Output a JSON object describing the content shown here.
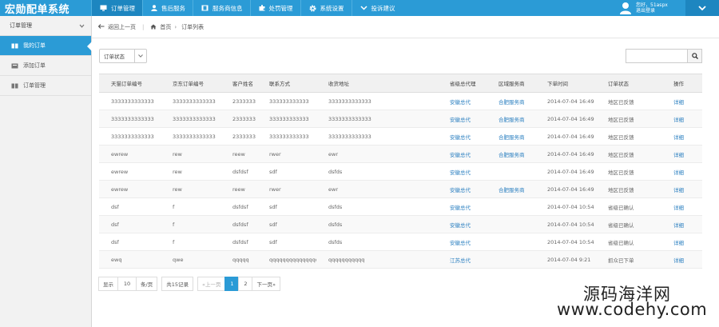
{
  "app": {
    "brand": "宏勋配单系统"
  },
  "nav": [
    {
      "label": "订单管理",
      "icon": "monitor-icon"
    },
    {
      "label": "售后服务",
      "icon": "user-icon"
    },
    {
      "label": "服务商信息",
      "icon": "film-icon"
    },
    {
      "label": "处罚管理",
      "icon": "puzzle-icon"
    },
    {
      "label": "系统设置",
      "icon": "gear-icon"
    },
    {
      "label": "投诉建议",
      "icon": "chevron-down-icon"
    }
  ],
  "user": {
    "welcome": "您好，51aspx",
    "logout": "退出登录"
  },
  "sidebar": {
    "header": "订单管理",
    "items": [
      {
        "label": "我的订单",
        "active": true
      },
      {
        "label": "添加订单",
        "active": false
      },
      {
        "label": "订单管理",
        "active": false
      }
    ]
  },
  "breadcrumb": {
    "back": "返回上一页",
    "home": "首页",
    "current": "订单列表"
  },
  "filter": {
    "status_label": "订单状态",
    "search_placeholder": ""
  },
  "table": {
    "columns": [
      "天猫订单编号",
      "京东订单编号",
      "客户姓名",
      "联系方式",
      "收货地址",
      "省级总代理",
      "区域服务商",
      "下单时间",
      "订单状态",
      "操作"
    ],
    "rows": [
      {
        "tmall": "3333333333333",
        "jd": "3333333333333",
        "name": "2333333",
        "phone": "333333333333",
        "address": "3333333333333",
        "agent": "安徽总代",
        "region": "合肥服务商",
        "time": "2014-07-04 16:49",
        "status": "地区已反馈",
        "status_color": "green",
        "op": "详细"
      },
      {
        "tmall": "3333333333333",
        "jd": "3333333333333",
        "name": "2333333",
        "phone": "333333333333",
        "address": "3333333333333",
        "agent": "安徽总代",
        "region": "合肥服务商",
        "time": "2014-07-04 16:49",
        "status": "地区已反馈",
        "status_color": "green",
        "op": "详细"
      },
      {
        "tmall": "3333333333333",
        "jd": "3333333333333",
        "name": "2333333",
        "phone": "333333333333",
        "address": "3333333333333",
        "agent": "安徽总代",
        "region": "合肥服务商",
        "time": "2014-07-04 16:49",
        "status": "地区已反馈",
        "status_color": "green",
        "op": "详细"
      },
      {
        "tmall": "ewrew",
        "jd": "rew",
        "name": "reew",
        "phone": "rwer",
        "address": "ewr",
        "agent": "安徽总代",
        "region": "合肥服务商",
        "time": "2014-07-04 16:49",
        "status": "地区已反馈",
        "status_color": "green",
        "op": "详细"
      },
      {
        "tmall": "ewrew",
        "jd": "rew",
        "name": "dsfdsf",
        "phone": "sdf",
        "address": "dsfds",
        "agent": "安徽总代",
        "region": "",
        "time": "2014-07-04 16:49",
        "status": "地区已反馈",
        "status_color": "green",
        "op": "详细"
      },
      {
        "tmall": "ewrew",
        "jd": "rew",
        "name": "reew",
        "phone": "rwer",
        "address": "ewr",
        "agent": "安徽总代",
        "region": "合肥服务商",
        "time": "2014-07-04 16:49",
        "status": "地区已反馈",
        "status_color": "green",
        "op": "详细"
      },
      {
        "tmall": "dsf",
        "jd": "f",
        "name": "dsfdsf",
        "phone": "sdf",
        "address": "dsfds",
        "agent": "安徽总代",
        "region": "",
        "time": "2014-07-04 10:54",
        "status": "省级已确认",
        "status_color": "purple",
        "op": "详细"
      },
      {
        "tmall": "dsf",
        "jd": "f",
        "name": "dsfdsf",
        "phone": "sdf",
        "address": "dsfds",
        "agent": "安徽总代",
        "region": "",
        "time": "2014-07-04 10:54",
        "status": "省级已确认",
        "status_color": "purple",
        "op": "详细"
      },
      {
        "tmall": "dsf",
        "jd": "f",
        "name": "dsfdsf",
        "phone": "sdf",
        "address": "dsfds",
        "agent": "安徽总代",
        "region": "",
        "time": "2014-07-04 10:54",
        "status": "省级已确认",
        "status_color": "purple",
        "op": "详细"
      },
      {
        "tmall": "ewq",
        "jd": "qwe",
        "name": "qqqqq",
        "phone": "qqqqqqqqqqqqqqq",
        "address": "qqqqqqqqqqq",
        "agent": "江苏总代",
        "region": "",
        "time": "2014-07-04 9:21",
        "status": "抓众已下单",
        "status_color": "blue",
        "op": "详细"
      }
    ]
  },
  "pager": {
    "show": "显示",
    "size": "10",
    "per_page": "条/页",
    "total": "共15记录",
    "prev": "«上一页",
    "pages": [
      "1",
      "2"
    ],
    "current": "1",
    "next": "下一页»"
  },
  "watermark": {
    "line1": "源码海洋网",
    "line2": "www.codehy.com"
  },
  "colors": {
    "primary": "#2b9bd6",
    "primary_dark": "#1d86c0",
    "green": "#1e9a3d",
    "purple": "#b43ec2",
    "link": "#2a7fc0"
  }
}
